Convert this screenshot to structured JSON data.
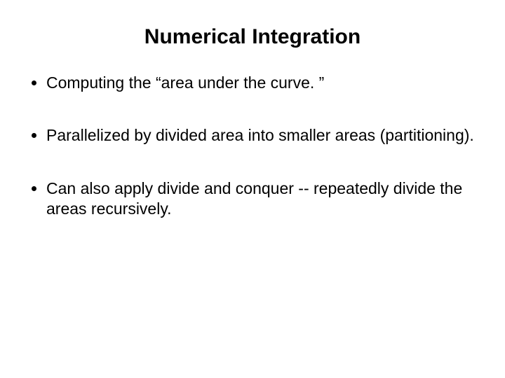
{
  "slide": {
    "title": "Numerical Integration",
    "bullets": [
      "Computing the “area under the curve. ”",
      "Parallelized by divided area into smaller areas (partitioning).",
      "Can also apply divide and conquer -- repeatedly divide the areas recursively."
    ]
  }
}
